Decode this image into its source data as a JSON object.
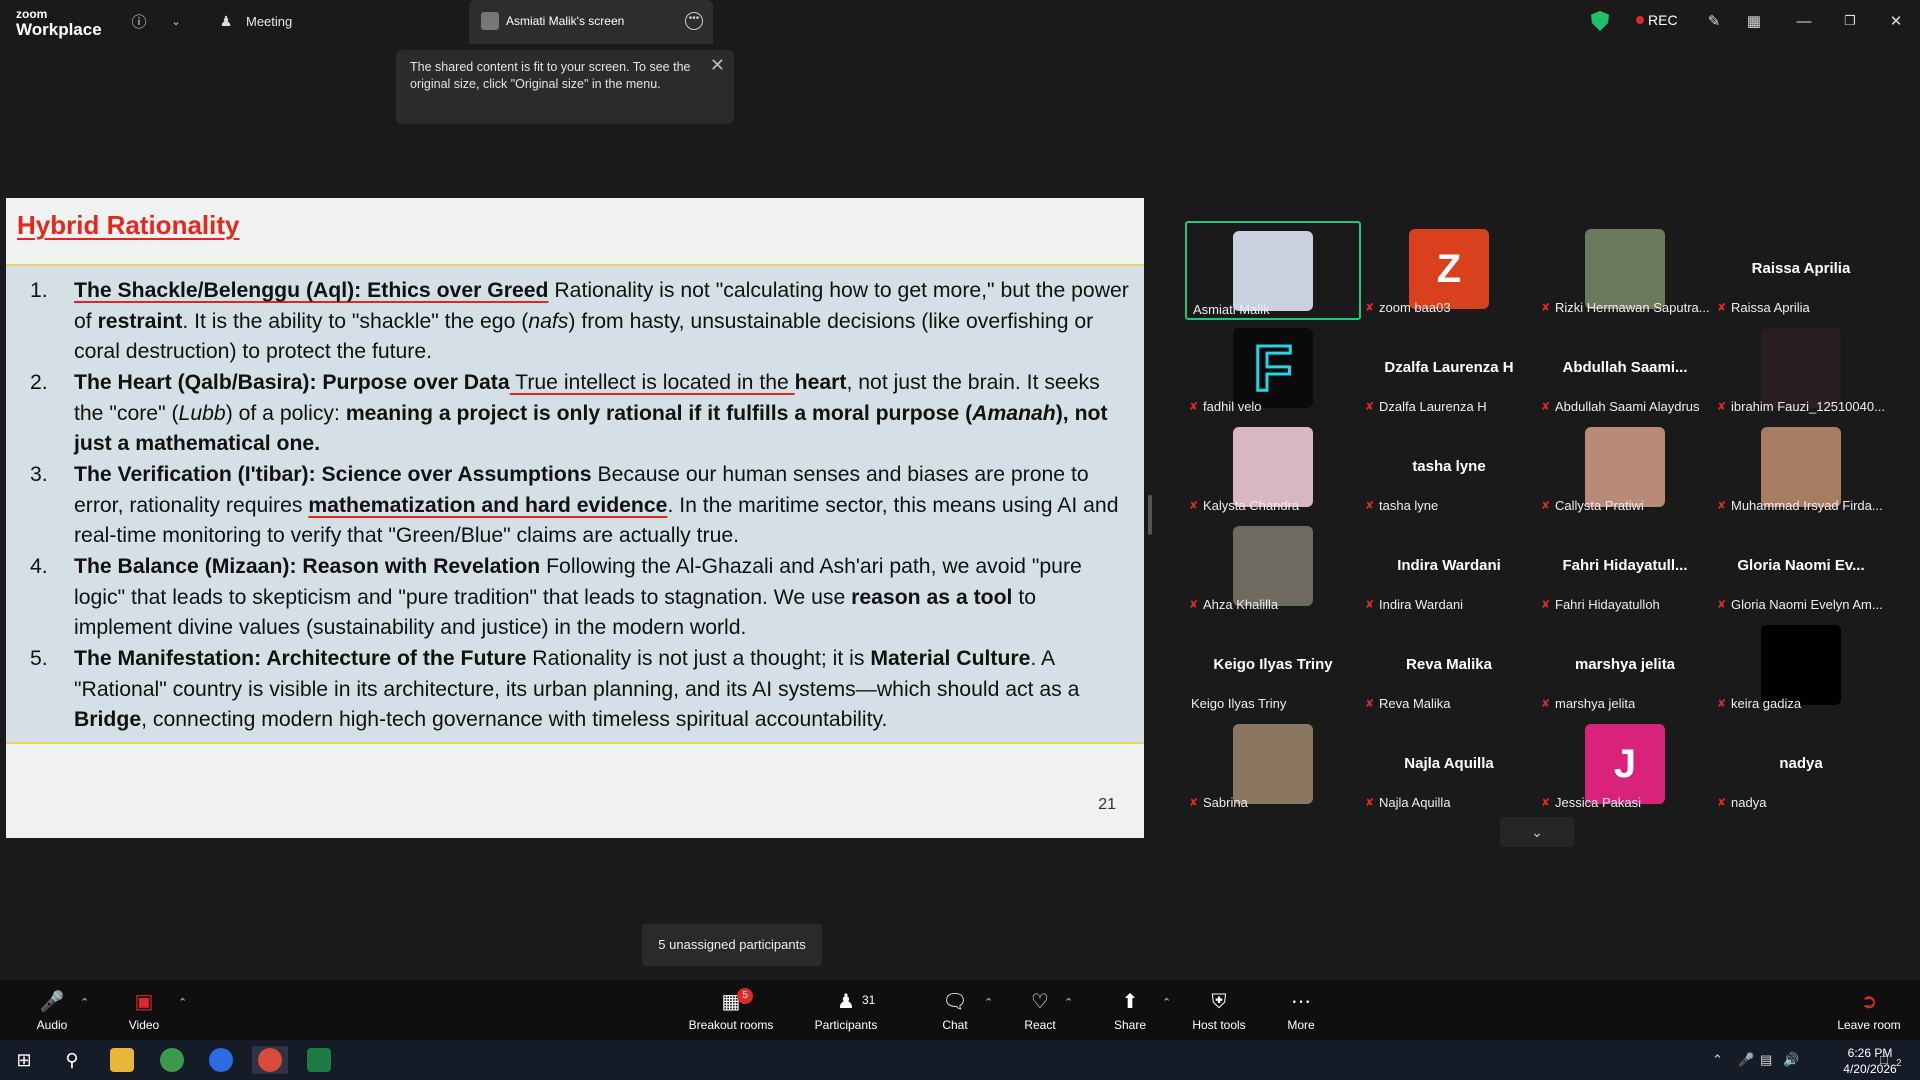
{
  "app": {
    "logo_line1": "zoom",
    "logo_line2": "Workplace",
    "meeting_label": "Meeting",
    "screen_tab_label": "Asmiati Malik's screen",
    "rec_label": "REC"
  },
  "notice": {
    "text": "The shared content is fit to your screen. To see the original size, click \"Original size\" in the menu."
  },
  "slide": {
    "title": "Hybrid  Rationality",
    "page_number": "21",
    "items": [
      {
        "num": "1.",
        "lead": "The Shackle/Belenggu (Aql): Ethics over Greed",
        "body": " Rationality is not \"calculating how to get more,\" but the power of ",
        "bold2": "restraint",
        "body2": ". It is the ability to \"shackle\" the ego (",
        "ital": "nafs",
        "body3": ") from hasty, unsustainable decisions (like overfishing or coral destruction) to protect the future."
      },
      {
        "num": "2.",
        "lead": "The Heart (Qalb/Basira): Purpose over Data",
        "body": " True intellect is located in the ",
        "bold2": "heart",
        "body2": ", not just the brain. It seeks the \"core\" (",
        "ital": "Lubb",
        "body3": ") of a policy: ",
        "bold3": "meaning a project is only rational if it fulfills a moral purpose (",
        "ital2": "Amanah",
        "bold4": "), not just a mathematical one."
      },
      {
        "num": "3.",
        "lead": "The Verification (I'tibar): Science over Assumptions",
        "body": " Because our human senses and biases are prone to error, rationality requires ",
        "bold2": "mathematization and hard evidence",
        "body2": ". In the maritime sector, this means using AI and real-time monitoring to verify that \"Green/Blue\" claims are actually true."
      },
      {
        "num": "4.",
        "lead": "The Balance (Mizaan): Reason with Revelation",
        "body": " Following the Al-Ghazali and Ash'ari path, we avoid \"pure logic\" that leads to skepticism and \"pure tradition\" that leads to stagnation. We use ",
        "bold2": "reason as a tool",
        "body2": " to implement divine values (sustainability and justice) in the modern world."
      },
      {
        "num": "5.",
        "lead": "The Manifestation: Architecture of the Future",
        "body": " Rationality is not just a thought; it is ",
        "bold2": "Material Culture",
        "body2": ". A \"Rational\" country is visible in its architecture, its urban planning, and its AI systems—which should act as a ",
        "bold3": "Bridge",
        "body3": ", connecting modern high-tech governance with timeless spiritual accountability."
      }
    ]
  },
  "participants": [
    {
      "name": "Asmiati Malik",
      "big": "",
      "letter": "",
      "color": "#c9d0de",
      "muted": false,
      "active": true
    },
    {
      "name": "zoom baa03",
      "big": "",
      "letter": "Z",
      "color": "#d9411e",
      "muted": true,
      "active": false
    },
    {
      "name": "Rizki Hermawan Saputra...",
      "big": "",
      "letter": "",
      "color": "#6b7a5a",
      "muted": true,
      "active": false
    },
    {
      "name": "Raissa Aprilia",
      "big": "Raissa Aprilia",
      "letter": "",
      "color": "",
      "muted": true,
      "active": false
    },
    {
      "name": "fadhil velo",
      "big": "",
      "letter": "F",
      "color": "#0a0a0a",
      "muted": true,
      "active": false
    },
    {
      "name": "Dzalfa Laurenza H",
      "big": "Dzalfa Laurenza H",
      "letter": "",
      "color": "",
      "muted": true,
      "active": false
    },
    {
      "name": "Abdullah Saami Alaydrus",
      "big": "Abdullah  Saami...",
      "letter": "",
      "color": "",
      "muted": true,
      "active": false
    },
    {
      "name": "ibrahim Fauzi_12510040...",
      "big": "",
      "letter": "",
      "color": "#2b1e22",
      "muted": true,
      "active": false
    },
    {
      "name": "Kalysta Chandra",
      "big": "",
      "letter": "",
      "color": "#d8b7c0",
      "muted": true,
      "active": false
    },
    {
      "name": "tasha lyne",
      "big": "tasha lyne",
      "letter": "",
      "color": "",
      "muted": true,
      "active": false
    },
    {
      "name": "Callysta Pratiwi",
      "big": "",
      "letter": "",
      "color": "#b98a78",
      "muted": true,
      "active": false
    },
    {
      "name": "Muhammad Irsyad Firda...",
      "big": "",
      "letter": "",
      "color": "#a67c62",
      "muted": true,
      "active": false
    },
    {
      "name": "Ahza Khalilla",
      "big": "",
      "letter": "",
      "color": "#6e6a60",
      "muted": true,
      "active": false
    },
    {
      "name": "Indira Wardani",
      "big": "Indira Wardani",
      "letter": "",
      "color": "",
      "muted": true,
      "active": false
    },
    {
      "name": "Fahri Hidayatulloh",
      "big": "Fahri  Hidayatull...",
      "letter": "",
      "color": "",
      "muted": true,
      "active": false
    },
    {
      "name": "Gloria Naomi Evelyn Am...",
      "big": "Gloria  Naomi  Ev...",
      "letter": "",
      "color": "",
      "muted": true,
      "active": false
    },
    {
      "name": "Keigo Ilyas Triny",
      "big": "Keigo Ilyas Triny",
      "letter": "",
      "color": "",
      "muted": false,
      "active": false
    },
    {
      "name": "Reva Malika",
      "big": "Reva Malika",
      "letter": "",
      "color": "",
      "muted": true,
      "active": false
    },
    {
      "name": "marshya jelita",
      "big": "marshya jelita",
      "letter": "",
      "color": "",
      "muted": true,
      "active": false
    },
    {
      "name": "keira gadiza",
      "big": "",
      "letter": "",
      "color": "#000000",
      "muted": true,
      "active": false
    },
    {
      "name": "Sabrina",
      "big": "",
      "letter": "",
      "color": "#8a7560",
      "muted": true,
      "active": false
    },
    {
      "name": "Najla Aquilla",
      "big": "Najla Aquilla",
      "letter": "",
      "color": "",
      "muted": true,
      "active": false
    },
    {
      "name": "Jessica Pakasi",
      "big": "",
      "letter": "J",
      "color": "#d9237a",
      "muted": true,
      "active": false
    },
    {
      "name": "nadya",
      "big": "nadya",
      "letter": "",
      "color": "",
      "muted": true,
      "active": false
    }
  ],
  "unassigned": "5 unassigned participants",
  "toolbar": {
    "audio": "Audio",
    "video": "Video",
    "breakout": "Breakout rooms",
    "breakout_badge": "5",
    "participants": "Participants",
    "participants_count": "31",
    "chat": "Chat",
    "react": "React",
    "share": "Share",
    "host_tools": "Host tools",
    "more": "More",
    "leave": "Leave room"
  },
  "taskbar": {
    "time": "6:26 PM",
    "date": "4/20/2026",
    "notif_count": "2"
  },
  "colors": {
    "accent_green": "#22c67a",
    "rec_red": "#e02828",
    "slide_title_red": "#e02b1c"
  }
}
